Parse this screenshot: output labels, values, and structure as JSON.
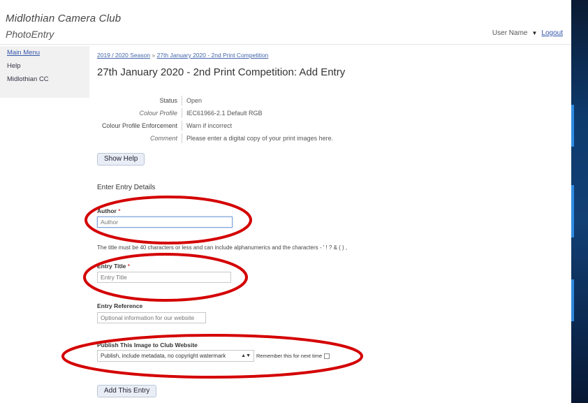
{
  "header": {
    "app_title": "Midlothian Camera Club",
    "app_subtitle": "PhotoEntry",
    "user_name": "User Name",
    "logout_label": "Logout"
  },
  "sidebar": {
    "items": [
      {
        "label": "Main Menu"
      },
      {
        "label": "Help"
      },
      {
        "label": "Midlothian CC"
      }
    ]
  },
  "breadcrumb": {
    "part1": "2019 / 2020 Season",
    "separator": "»",
    "part2": "27th January 2020 - 2nd Print Competition"
  },
  "page_title": "27th January 2020 - 2nd Print Competition: Add Entry",
  "info_rows": [
    {
      "label": "Status",
      "value": "Open"
    },
    {
      "label": "Colour Profile",
      "value": "IEC61966-2.1 Default RGB"
    },
    {
      "label": "Colour Profile Enforcement",
      "value": "Warn if incorrect"
    },
    {
      "label": "Comment",
      "value": "Please enter a digital copy of your print images here."
    }
  ],
  "buttons": {
    "show_help": "Show Help",
    "add_entry": "Add This Entry"
  },
  "form": {
    "section_heading": "Enter Entry Details",
    "author": {
      "label": "Author",
      "required_mark": "*",
      "placeholder": "Author"
    },
    "author_help": "The title must be 40 characters or less and can include alphanumerics and the characters - ' ! ? & ( ) ,",
    "title": {
      "label": "Entry Title",
      "required_mark": "*",
      "placeholder": "Entry Title"
    },
    "reference": {
      "label": "Entry Reference",
      "placeholder": "Optional information for our website"
    },
    "publish": {
      "label": "Publish This Image to Club Website",
      "selected": "Publish, include metadata, no copyright watermark",
      "arrow": "▲▼",
      "checkbox_label": "Remember this for next time"
    }
  },
  "colors": {
    "annotation_red": "#d40000",
    "link_blue": "#3355aa"
  }
}
